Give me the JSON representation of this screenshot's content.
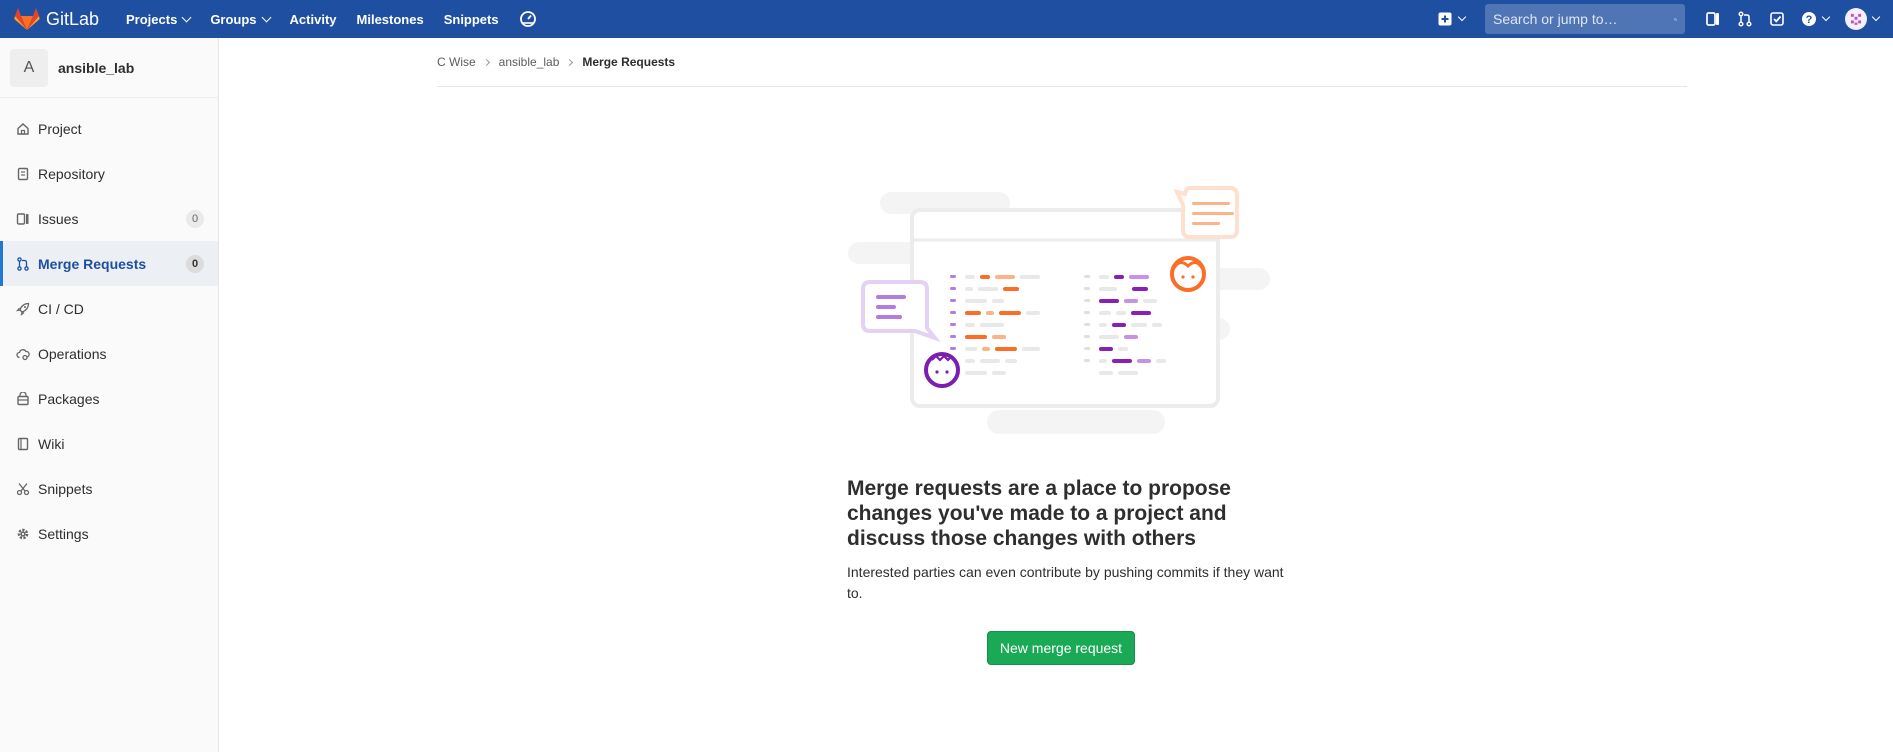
{
  "app": {
    "brand": "GitLab",
    "accent_color": "#1f4fa0",
    "nav": [
      {
        "label": "Projects",
        "has_dropdown": true
      },
      {
        "label": "Groups",
        "has_dropdown": true
      },
      {
        "label": "Activity",
        "has_dropdown": false
      },
      {
        "label": "Milestones",
        "has_dropdown": false
      },
      {
        "label": "Snippets",
        "has_dropdown": false
      }
    ],
    "search_placeholder": "Search or jump to…",
    "icons": [
      "gitlab-logo-icon",
      "performance-bar-icon",
      "plus-square-icon",
      "issues-icon",
      "merge-request-icon",
      "todo-icon",
      "help-icon",
      "user-avatar-icon"
    ]
  },
  "sidebar": {
    "project_initial": "A",
    "project_name": "ansible_lab",
    "items": [
      {
        "label": "Project",
        "icon": "home-icon"
      },
      {
        "label": "Repository",
        "icon": "repository-icon"
      },
      {
        "label": "Issues",
        "icon": "issues-icon",
        "badge": "0"
      },
      {
        "label": "Merge Requests",
        "icon": "merge-request-icon",
        "badge": "0",
        "active": true
      },
      {
        "label": "CI / CD",
        "icon": "rocket-icon"
      },
      {
        "label": "Operations",
        "icon": "cloud-gear-icon"
      },
      {
        "label": "Packages",
        "icon": "package-icon"
      },
      {
        "label": "Wiki",
        "icon": "book-icon"
      },
      {
        "label": "Snippets",
        "icon": "scissors-icon"
      },
      {
        "label": "Settings",
        "icon": "gear-icon"
      }
    ]
  },
  "breadcrumb": {
    "items": [
      "C Wise",
      "ansible_lab"
    ],
    "current": "Merge Requests"
  },
  "empty_state": {
    "title": "Merge requests are a place to propose changes you've made to a project and discuss those changes with others",
    "text": "Interested parties can even contribute by pushing commits if they want to.",
    "button": "New merge request",
    "button_color": "#1aaa55"
  }
}
